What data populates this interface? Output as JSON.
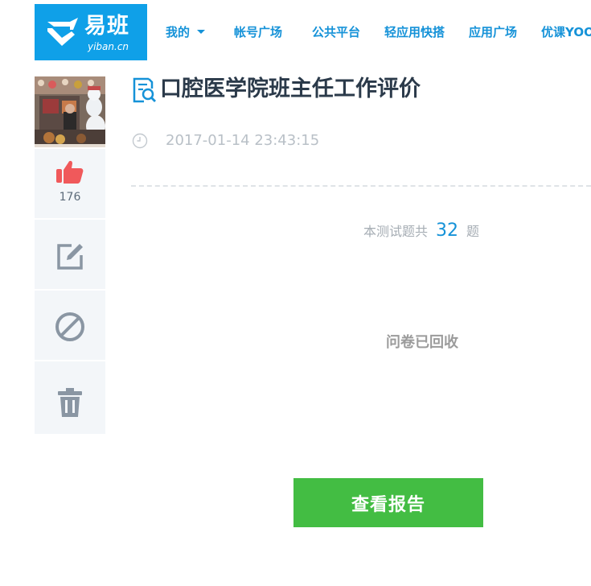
{
  "brand": {
    "name": "易班",
    "domain": "yiban.cn",
    "color": "#0fa0e8",
    "icon": "yiban-logo-icon"
  },
  "nav": {
    "items": [
      {
        "label": "我的",
        "dropdown": true
      },
      {
        "label": "帐号广场"
      },
      {
        "label": "公共平台"
      },
      {
        "label": "轻应用快搭"
      },
      {
        "label": "应用广场"
      },
      {
        "label": "优课YOOC"
      }
    ],
    "color": "#1592d8"
  },
  "sidebar": {
    "avatar_icon": "user-avatar",
    "like": {
      "icon": "thumbs-up-icon",
      "count": "176",
      "color": "#f0595b"
    },
    "edit": {
      "icon": "edit-icon"
    },
    "block": {
      "icon": "block-icon"
    },
    "delete": {
      "icon": "trash-icon"
    },
    "icon_color": "#8a96a3"
  },
  "survey": {
    "title_icon": "survey-search-icon",
    "title": "口腔医学院班主任工作评价",
    "time_icon": "clock-icon",
    "timestamp": "2017-01-14 23:43:15",
    "question_prefix": "本测试题共",
    "question_count": "32",
    "question_suffix": "题",
    "status": "问卷已回收",
    "report_button": "查看报告",
    "button_color": "#43bd43"
  }
}
